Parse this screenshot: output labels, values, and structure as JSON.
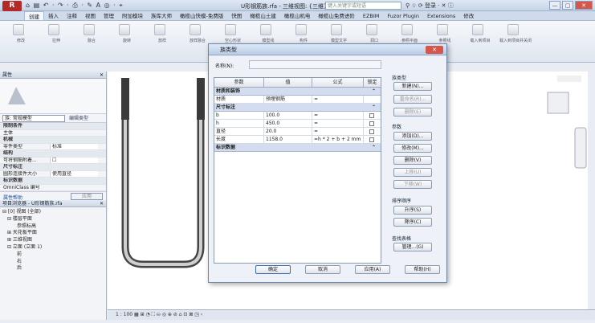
{
  "app": {
    "logo": "R",
    "quick_access": "⌂ ▤ ↶ · ↷ · ⎙ · ✎ A ◎ · ⌖",
    "window_title": "U形钢筋族.rfa - 三维视图: {三维}",
    "search_placeholder": "键入关键字或短语",
    "title_right": "⚲ ☆ ⟳ 登录 · ✕ ⓘ",
    "win_btns": [
      "—",
      "▢",
      "✕"
    ]
  },
  "ribbon_tabs": [
    "创建",
    "插入",
    "注释",
    "视图",
    "管理",
    "附加模块",
    "族库大师",
    "橄榄山快模-免费版",
    "快图",
    "橄榄山土建",
    "橄榄山机电",
    "橄榄山免费进阶",
    "EZBIM",
    "Fuzor Plugin",
    "Extensions",
    "修改"
  ],
  "ribbon_labels": [
    "修改",
    "拉伸",
    "融合",
    "旋转",
    "放样",
    "放样融合",
    "空心形状",
    "模型线",
    "构件",
    "模型文字",
    "洞口",
    "参照平面",
    "参照线",
    "载入到项目",
    "载入到项目并关闭"
  ],
  "properties": {
    "header": "属性",
    "type_selector": "族: 常规模型",
    "edit_type": "编辑类型",
    "rows": [
      {
        "label": "限制条件",
        "value": "",
        "cat": true
      },
      {
        "label": "主体",
        "value": "",
        "cat": false
      },
      {
        "label": "机械",
        "value": "",
        "cat": true
      },
      {
        "label": "零件类型",
        "value": "标准",
        "cat": false
      },
      {
        "label": "结构",
        "value": "",
        "cat": true
      },
      {
        "label": "可将钢筋附着...",
        "value": "☐",
        "cat": false
      },
      {
        "label": "尺寸标注",
        "value": "",
        "cat": true
      },
      {
        "label": "圆形连接件大小",
        "value": "使用直径",
        "cat": false
      },
      {
        "label": "标识数据",
        "value": "",
        "cat": true
      },
      {
        "label": "OmniClass 编号",
        "value": "",
        "cat": false
      }
    ],
    "help_link": "属性帮助",
    "apply": "应用"
  },
  "browser": {
    "header": "项目浏览器 - U形钢筋族.rfa",
    "items": [
      {
        "text": "⊟ [0] 视图 (全部)",
        "indent": 0
      },
      {
        "text": "⊟ 楼层平面",
        "indent": 1
      },
      {
        "text": "参照标高",
        "indent": 3
      },
      {
        "text": "⊞ 天花板平面",
        "indent": 1
      },
      {
        "text": "⊞ 三维视图",
        "indent": 1
      },
      {
        "text": "⊟ 立面 (立面 1)",
        "indent": 1
      },
      {
        "text": "前",
        "indent": 3
      },
      {
        "text": "右",
        "indent": 3
      },
      {
        "text": "后",
        "indent": 3
      }
    ]
  },
  "status_bar": "1 : 100   ▦ ⊞ ◔ ⛶ ⛀ ◎ ⊕ ⊘ ⌂ ⊡ ⊠ ◳ ‹",
  "dialog": {
    "title": "族类型",
    "name_label": "名称(N):",
    "columns": [
      "参数",
      "值",
      "公式",
      "锁定"
    ],
    "sections": [
      {
        "name": "材质和装饰",
        "rows": [
          {
            "param": "材质",
            "value": "预埋钢筋",
            "formula": "=",
            "lock": false
          }
        ]
      },
      {
        "name": "尺寸标注",
        "rows": [
          {
            "param": "b",
            "value": "100.0",
            "formula": "=",
            "lock": true
          },
          {
            "param": "h",
            "value": "450.0",
            "formula": "=",
            "lock": true
          },
          {
            "param": "直径",
            "value": "20.0",
            "formula": "=",
            "lock": true
          },
          {
            "param": "长度",
            "value": "1158.0",
            "formula": "=h * 2 + b + 2 mm",
            "lock": true
          }
        ]
      },
      {
        "name": "标识数据",
        "rows": []
      }
    ],
    "family_types_label": "族类型",
    "family_type_buttons": [
      "新建(N)...",
      "重命名(R)...",
      "删除(E)"
    ],
    "params_label": "参数",
    "param_buttons": [
      "添加(D)...",
      "修改(M)...",
      "删除(V)",
      "上移(U)",
      "下移(W)"
    ],
    "sort_label": "排序顺序",
    "sort_buttons": [
      "升序(S)",
      "降序(C)"
    ],
    "lookup_label": "查找表格",
    "lookup_button": "管理...(G)",
    "footer": {
      "ok": "确定",
      "cancel": "取消",
      "apply": "应用(A)",
      "help": "帮助(H)"
    }
  }
}
